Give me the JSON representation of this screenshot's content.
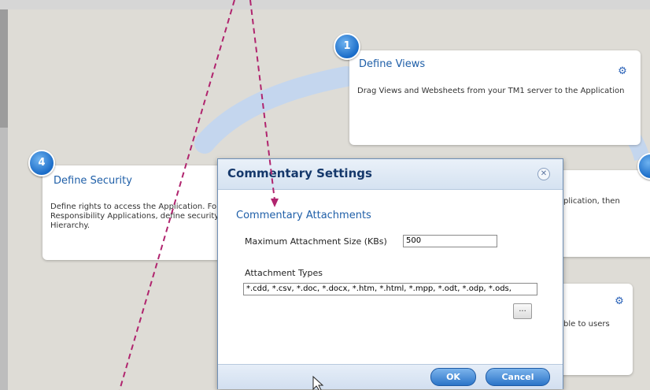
{
  "steps": [
    {
      "number": "1",
      "title": "Define Views",
      "description": "Drag Views and Websheets from your TM1 server to the Application"
    },
    {
      "number": "4",
      "title": "Define Security",
      "description_lines": [
        "Define rights to access the Application. Fo",
        "Responsibility Applications, define security",
        "Hierarchy."
      ]
    }
  ],
  "step2_partial_text": "plication, then",
  "step3_partial_text": "ble to users",
  "dialog": {
    "title": "Commentary Settings",
    "close_symbol": "✕",
    "section_title": "Commentary Attachments",
    "max_size_label": "Maximum Attachment Size (KBs)",
    "max_size_value": "500",
    "types_label": "Attachment Types",
    "types_value": "*.cdd, *.csv, *.doc, *.docx, *.htm, *.html, *.mpp, *.odt, *.odp, *.ods,",
    "browse_label": "...",
    "ok_label": "OK",
    "cancel_label": "Cancel"
  },
  "icons": [
    "gear-icon",
    "close-icon",
    "mouse-cursor-icon"
  ],
  "colors": {
    "accent": "#1f5fa8",
    "annotation": "#b0246e",
    "arc": "#c4d6ee"
  }
}
